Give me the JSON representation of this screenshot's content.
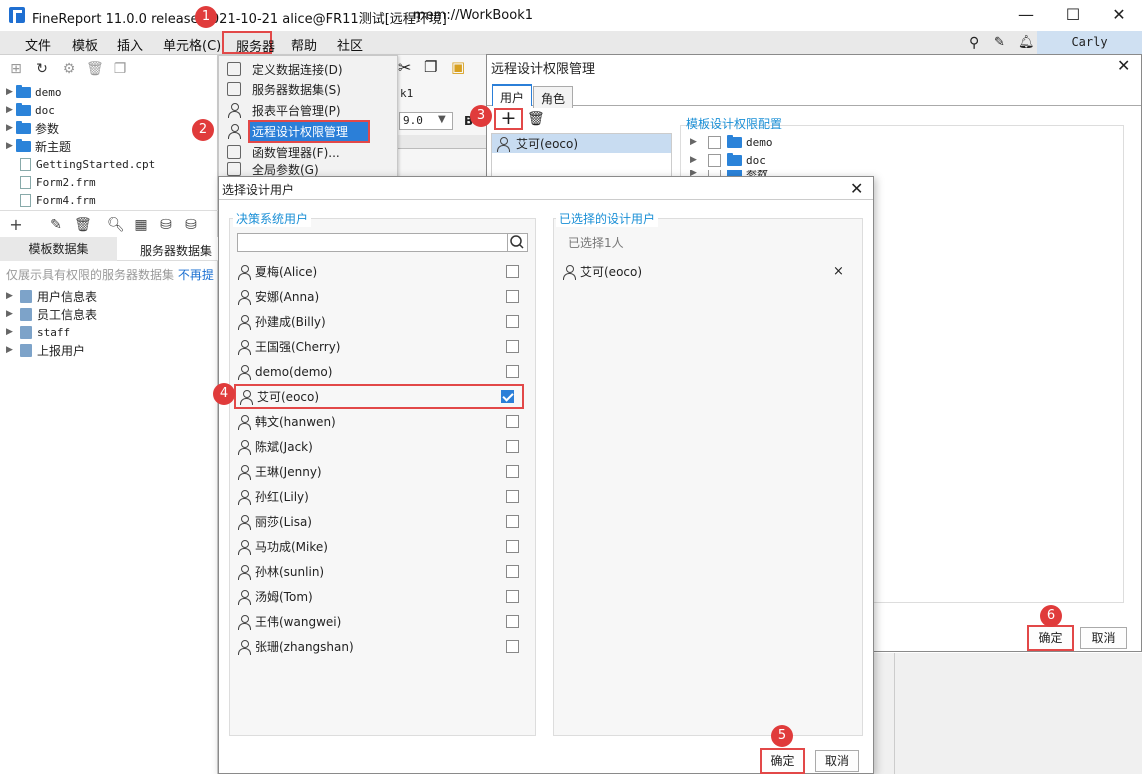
{
  "window": {
    "title": "FineReport 11.0.0 release 2021-10-21 alice@FR11测试[远程环境]",
    "file": "mem://WorkBook1",
    "minimize": "—",
    "maximize": "☐",
    "close": "✕"
  },
  "menubar": {
    "items": [
      "文件",
      "模板",
      "插入",
      "单元格(C)",
      "服务器",
      "帮助",
      "社区"
    ]
  },
  "user": {
    "name": "Carly"
  },
  "file_tree": {
    "items": [
      {
        "name": "demo",
        "type": "folder"
      },
      {
        "name": "doc",
        "type": "folder"
      },
      {
        "name": "参数",
        "type": "folder"
      },
      {
        "name": "新主题",
        "type": "folder"
      },
      {
        "name": "GettingStarted.cpt",
        "type": "file"
      },
      {
        "name": "Form2.frm",
        "type": "file"
      },
      {
        "name": "Form4.frm",
        "type": "file"
      }
    ]
  },
  "dataset": {
    "tabs": [
      "模板数据集",
      "服务器数据集"
    ],
    "hint": "仅展示具有权限的服务器数据集",
    "hint_link": "不再提",
    "items": [
      "用户信息表",
      "员工信息表",
      "staff",
      "上报用户"
    ]
  },
  "server_menu": {
    "items": [
      "定义数据连接(D)",
      "服务器数据集(S)",
      "报表平台管理(P)",
      "远程设计权限管理",
      "函数管理器(F)...",
      "全局参数(G)"
    ]
  },
  "editor": {
    "tab_label": "k1",
    "font_size": "9.0",
    "bold": "B"
  },
  "remote_dialog": {
    "title": "远程设计权限管理",
    "tabs": [
      "用户",
      "角色"
    ],
    "add": "+",
    "selected_user": "艾可(eoco)",
    "config_title": "模板设计权限配置",
    "tree": [
      "demo",
      "doc",
      "参数"
    ],
    "ok": "确定",
    "cancel": "取消"
  },
  "select_dialog": {
    "title": "选择设计用户",
    "left_title": "决策系统用户",
    "right_title": "已选择的设计用户",
    "selected_count": "已选择1人",
    "selected_users": [
      "艾可(eoco)"
    ],
    "users": [
      {
        "name": "夏梅(Alice)",
        "checked": false
      },
      {
        "name": "安娜(Anna)",
        "checked": false
      },
      {
        "name": "孙建成(Billy)",
        "checked": false
      },
      {
        "name": "王国强(Cherry)",
        "checked": false
      },
      {
        "name": "demo(demo)",
        "checked": false
      },
      {
        "name": "艾可(eoco)",
        "checked": true
      },
      {
        "name": "韩文(hanwen)",
        "checked": false
      },
      {
        "name": "陈斌(Jack)",
        "checked": false
      },
      {
        "name": "王琳(Jenny)",
        "checked": false
      },
      {
        "name": "孙红(Lily)",
        "checked": false
      },
      {
        "name": "丽莎(Lisa)",
        "checked": false
      },
      {
        "name": "马功成(Mike)",
        "checked": false
      },
      {
        "name": "孙林(sunlin)",
        "checked": false
      },
      {
        "name": "汤姆(Tom)",
        "checked": false
      },
      {
        "name": "王伟(wangwei)",
        "checked": false
      },
      {
        "name": "张珊(zhangshan)",
        "checked": false
      }
    ],
    "remove": "×",
    "ok": "确定",
    "cancel": "取消"
  },
  "steps": [
    "1",
    "2",
    "3",
    "4",
    "5",
    "6"
  ],
  "colors": {
    "accent": "#2b7fd8",
    "highlight_red": "#e24848",
    "section_title": "#1a8fd6"
  }
}
